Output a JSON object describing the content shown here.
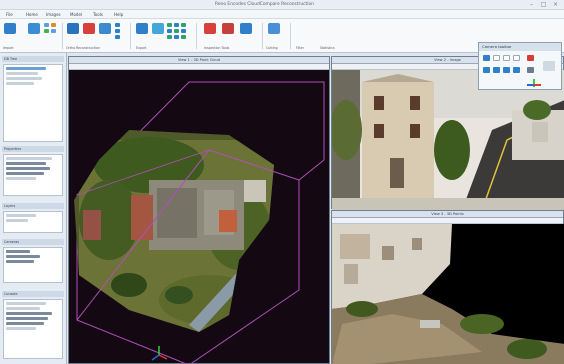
{
  "app": {
    "title": "Reno Encodes CloudCompare Reconstruction",
    "window_controls": [
      "–",
      "□",
      "×"
    ]
  },
  "menu": [
    "File",
    "Home",
    "Images",
    "Model",
    "Tools",
    "Help"
  ],
  "ribbon": {
    "groups": [
      {
        "label": "Import"
      },
      {
        "label": "Ortho Reconstruction"
      },
      {
        "label": "Export"
      },
      {
        "label": "Inspection Tools"
      },
      {
        "label": "Cutting"
      },
      {
        "label": "Filter"
      },
      {
        "label": "Statistics"
      }
    ],
    "accent": "#2f7fc9"
  },
  "left_panel": {
    "sections": [
      {
        "title": "DB Tree"
      },
      {
        "title": "Properties"
      },
      {
        "title": "Layers"
      },
      {
        "title": "Cameras"
      },
      {
        "title": "Console"
      }
    ]
  },
  "viewports": {
    "main": {
      "title": "View 1 - 3D Point Cloud"
    },
    "top_right": {
      "title": "View 2 - Image"
    },
    "bottom_right": {
      "title": "View 3 - 3D Points"
    }
  },
  "widget": {
    "title": "Camera toolbar"
  },
  "colors": {
    "viewport_bg": "#140812",
    "bbox": "#b04fb9",
    "ui_bg": "#dfe6ee",
    "axis_green": "#2fd035",
    "axis_blue": "#2d63e0",
    "axis_red": "#d73c35"
  }
}
